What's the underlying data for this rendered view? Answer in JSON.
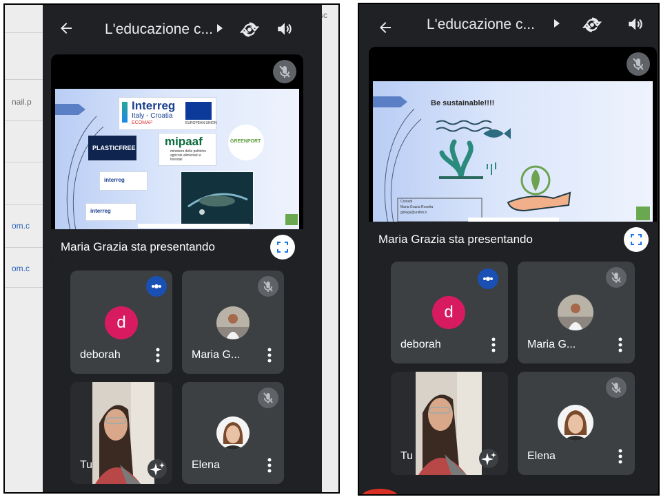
{
  "call": {
    "title": "L'educazione c...",
    "presenter_status": "Maria Grazia sta presentando"
  },
  "background_page": {
    "partial_texts": [
      "nail.p",
      "om.c",
      "om.c"
    ],
    "corner_text": "sc"
  },
  "slide1": {
    "logos": {
      "interreg_main": "Interreg",
      "interreg_sub": "Italy - Croatia",
      "interreg_project": "ECOMAP",
      "eu_label": "EUROPEAN UNION",
      "plasticfree": "PLASTICFREE",
      "mipaaf": "mipaaf",
      "mipaaf_sub": "ministero delle politiche agricole alimentari e forestali",
      "greenport": "GREENPORT",
      "interreg_small_1": "interreg",
      "interreg_small_2": "interreg"
    }
  },
  "slide2": {
    "heading": "Be sustainable!!!!",
    "contacts": [
      "Contatti",
      "Maria Grazia Rosetta",
      "gdregs@unifeb.it"
    ]
  },
  "participants_shot1": [
    {
      "name": "deborah",
      "initial": "d"
    },
    {
      "name": "Maria G..."
    },
    {
      "name": "Tu"
    },
    {
      "name": "Elena"
    }
  ],
  "participants_shot2": [
    {
      "name": "deborah",
      "initial": "d"
    },
    {
      "name": "Maria G..."
    },
    {
      "name": "Tu"
    },
    {
      "name": "Elena"
    }
  ],
  "colors": {
    "app_bg": "#202124",
    "tile_bg": "#3c4043",
    "avatar_d": "#d81b60",
    "speaking_badge": "#1a4fb4",
    "mute_badge": "#5f6368"
  },
  "icons": [
    "back-arrow-icon",
    "play-caret-icon",
    "switch-camera-icon",
    "speaker-icon",
    "mic-off-icon",
    "fullscreen-icon",
    "more-vert-icon",
    "speaking-dots-icon",
    "sparkle-effects-icon"
  ]
}
